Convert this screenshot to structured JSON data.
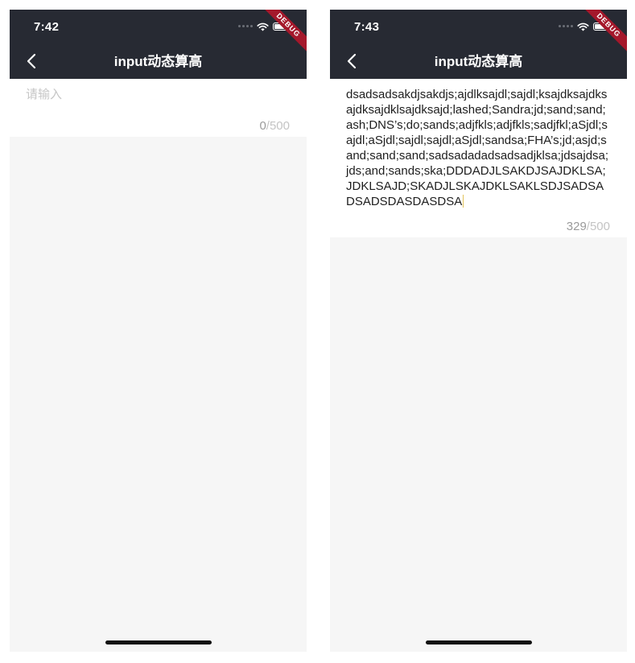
{
  "screens": [
    {
      "status_time": "7:42",
      "debug_badge": "DEBUG",
      "title": "input动态算高",
      "input": {
        "placeholder": "请输入",
        "value": ""
      },
      "counter": {
        "current": "0",
        "separator": "/",
        "max": "500"
      }
    },
    {
      "status_time": "7:43",
      "debug_badge": "DEBUG",
      "title": "input动态算高",
      "input": {
        "placeholder": "",
        "value": "dsadsadsakdjsakdjs;ajdlksajdl;sajdl;ksajdksajdksajdksajdklsajdksajd;lashed;Sandra;jd;sand;sand;ash;DNS’s;do;sands;adjfkls;adjfkls;sadjfkl;aSjdl;sajdl;aSjdl;sajdl;sajdl;aSjdl;sandsa;FHA’s;jd;asjd;sand;sand;sand;sadsadadadsadsadjklsa;jdsajdsa;jds;and;sands;ska;DDDADJLSAKDJSAJDKLSA;JDKLSAJD;SKADJLSKAJDKLSAKLSDJSADSADSADSDASDASDSA"
      },
      "counter": {
        "current": "329",
        "separator": "/",
        "max": "500"
      }
    }
  ],
  "icons": {
    "back": "chevron-left-icon",
    "wifi": "wifi-icon",
    "battery": "battery-icon",
    "signal": "signal-dots-icon"
  },
  "colors": {
    "appbar": "#272a33",
    "body_background": "#f6f6f6",
    "debug_ribbon": "#a4182b",
    "placeholder": "#c6c6c6",
    "caret": "#e2c35a"
  }
}
